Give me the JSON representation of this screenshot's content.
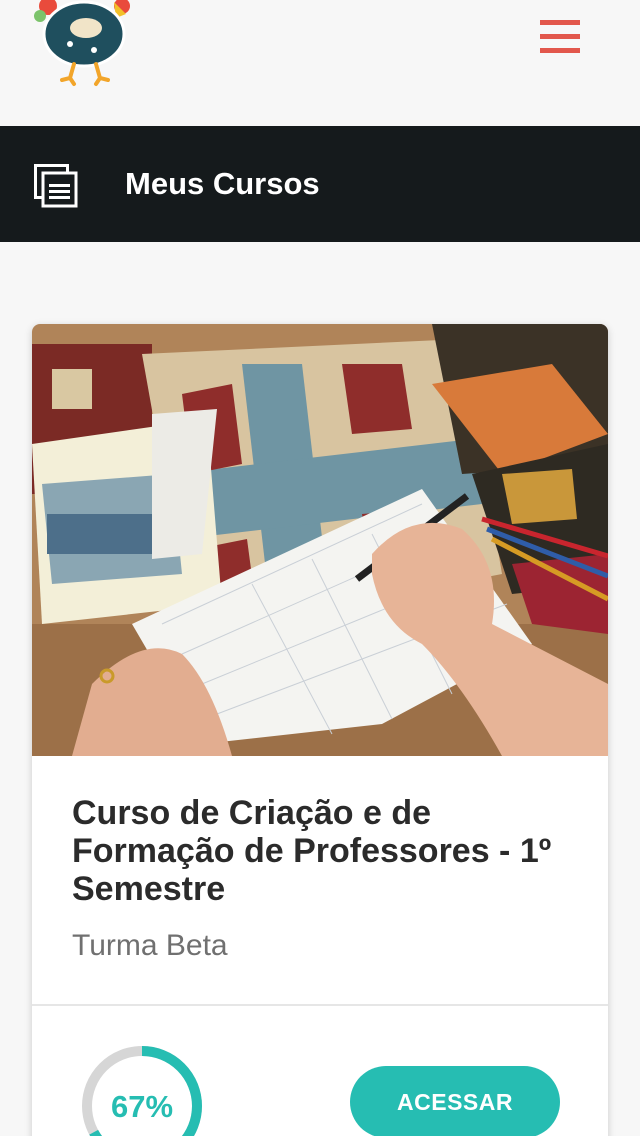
{
  "header": {
    "logo_icon": "rooster-logo-icon",
    "menu_icon": "hamburger-menu-icon",
    "menu_color": "#e2574c"
  },
  "section": {
    "icon": "courses-list-icon",
    "title": "Meus Cursos",
    "background": "#151a1c"
  },
  "course": {
    "image": "quilting-notebook-photo",
    "title": "Curso de Criação e de Formação de Professores - 1º Semestre",
    "class_name": "Turma Beta",
    "progress_percent": 67,
    "progress_label": "67%",
    "button_label": "ACESSAR",
    "accent": "#26bdb2"
  }
}
